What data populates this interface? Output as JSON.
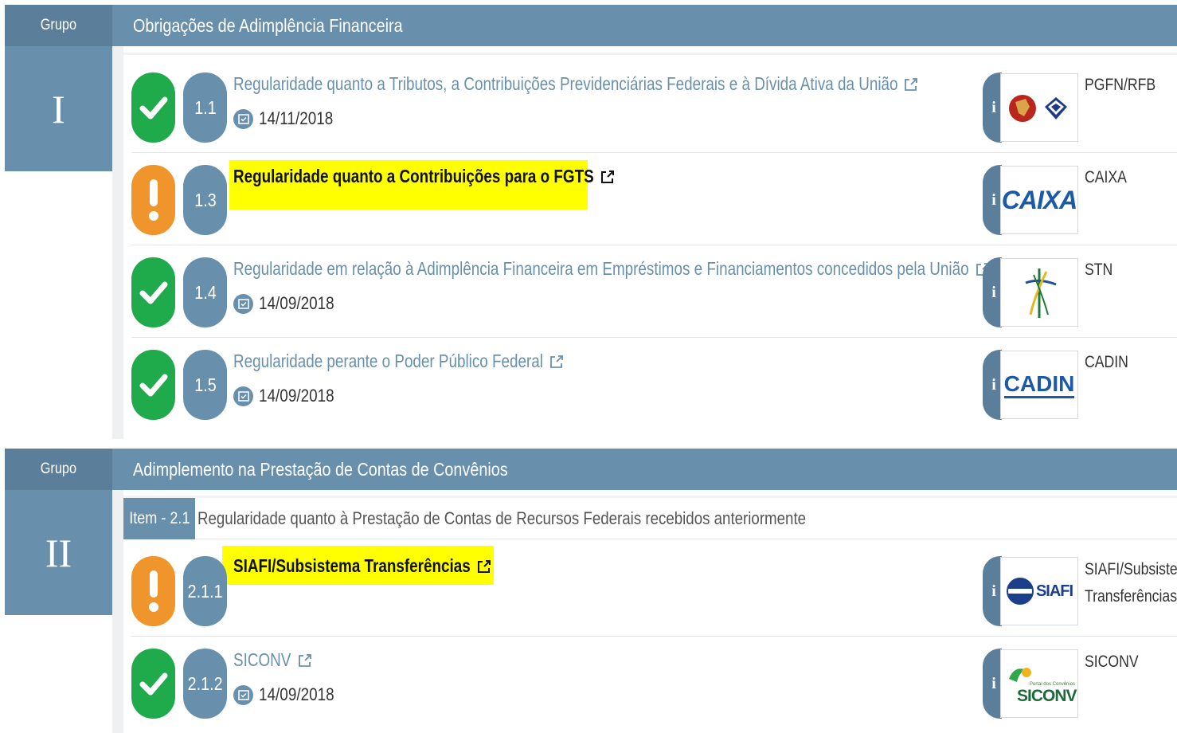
{
  "groups": [
    {
      "header_label": "Grupo",
      "roman": "I",
      "title": "Obrigações de Adimplência Financeira",
      "rows": [
        {
          "status": "ok",
          "number": "1.1",
          "link": "Regularidade quanto a Tributos, a Contribuições Previdenciárias Federais e à Dívida Ativa da União",
          "date": "14/11/2018",
          "org": "PGFN/RFB",
          "logo": "pgfn-rfb-logo"
        },
        {
          "status": "warn",
          "number": "1.3",
          "link": "Regularidade quanto a Contribuições para o FGTS",
          "date": "",
          "org": "CAIXA",
          "logo": "caixa-logo",
          "logo_text": "CAIXA",
          "highlighted": true
        },
        {
          "status": "ok",
          "number": "1.4",
          "link": "Regularidade em relação à Adimplência Financeira em Empréstimos e Financiamentos concedidos pela União",
          "date": "14/09/2018",
          "org": "STN",
          "logo": "stn-logo"
        },
        {
          "status": "ok",
          "number": "1.5",
          "link": "Regularidade perante o Poder Público Federal",
          "date": "14/09/2018",
          "org": "CADIN",
          "logo": "cadin-logo",
          "logo_text": "CADIN"
        }
      ]
    },
    {
      "header_label": "Grupo",
      "roman": "II",
      "title": "Adimplemento na Prestação de Contas de Convênios",
      "item_header": {
        "tag": "Item - 2.1",
        "description": "Regularidade quanto à Prestação de Contas de Recursos Federais recebidos anteriormente"
      },
      "rows": [
        {
          "status": "warn",
          "number": "2.1.1",
          "link": "SIAFI/Subsistema Transferências",
          "date": "",
          "org_line1": "SIAFI/Subsistem",
          "org_line2": "Transferências",
          "logo": "siafi-logo",
          "logo_text": "SIAFI",
          "highlighted": true
        },
        {
          "status": "ok",
          "number": "2.1.2",
          "link": "SICONV",
          "date": "14/09/2018",
          "org": "SICONV",
          "logo": "siconv-logo",
          "logo_text": "SICONV",
          "logo_subtext": "Portal dos Convênios"
        }
      ]
    }
  ],
  "info_label": "i",
  "colors": {
    "header_dark": "#5b7f9b",
    "header": "#6890ac",
    "ok": "#1faa4b",
    "warn": "#f0952b",
    "highlight": "#ffff00"
  }
}
